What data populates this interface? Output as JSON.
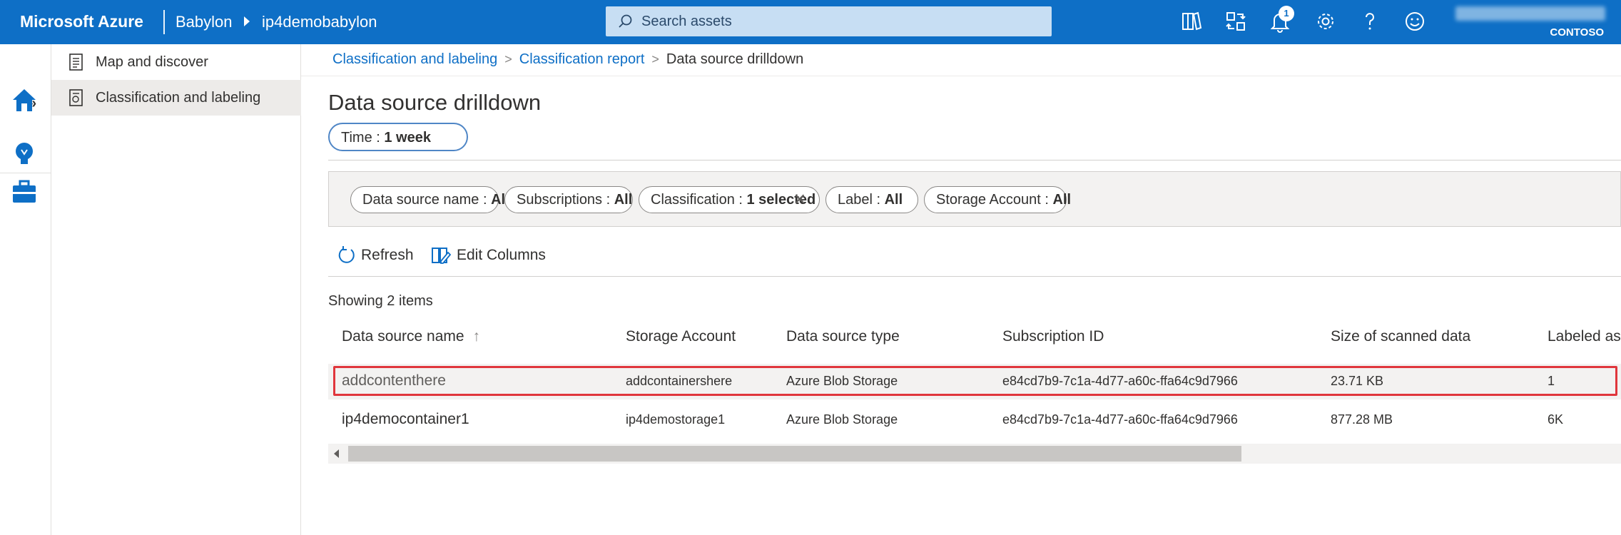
{
  "header": {
    "brand": "Microsoft Azure",
    "crumb1": "Babylon",
    "crumb2": "ip4demobabylon",
    "search_placeholder": "Search assets",
    "notification_count": "1",
    "org": "CONTOSO"
  },
  "nav": {
    "items": [
      {
        "label": "Map and discover"
      },
      {
        "label": "Classification and labeling"
      }
    ]
  },
  "breadcrumb": {
    "items": [
      "Classification and labeling",
      "Classification report"
    ],
    "current": "Data source drilldown"
  },
  "page": {
    "title": "Data source drilldown",
    "time_label": "Time : ",
    "time_value": "1 week"
  },
  "filters": [
    {
      "label": "Data source name : ",
      "value": "All"
    },
    {
      "label": "Subscriptions : ",
      "value": "All"
    },
    {
      "label": "Classification : ",
      "value": "1 selected"
    },
    {
      "label": "Label : ",
      "value": "All"
    },
    {
      "label": "Storage Account : ",
      "value": "All"
    }
  ],
  "toolbar": {
    "refresh": "Refresh",
    "edit_columns": "Edit Columns"
  },
  "showing": "Showing 2 items",
  "table": {
    "columns": [
      "Data source name",
      "Storage Account",
      "Data source type",
      "Subscription ID",
      "Size of scanned data",
      "Labeled as"
    ],
    "sort_indicator": "↑",
    "rows": [
      [
        "addcontenthere",
        "addcontainershere",
        "Azure Blob Storage",
        "e84cd7b9-7c1a-4d77-a60c-ffa64c9d7966",
        "23.71 KB",
        "1"
      ],
      [
        "ip4democontainer1",
        "ip4demostorage1",
        "Azure Blob Storage",
        "e84cd7b9-7c1a-4d77-a60c-ffa64c9d7966",
        "877.28 MB",
        "6K"
      ]
    ]
  },
  "colors": {
    "azure_blue": "#0e6fc6",
    "highlight_red": "#e0363c"
  }
}
